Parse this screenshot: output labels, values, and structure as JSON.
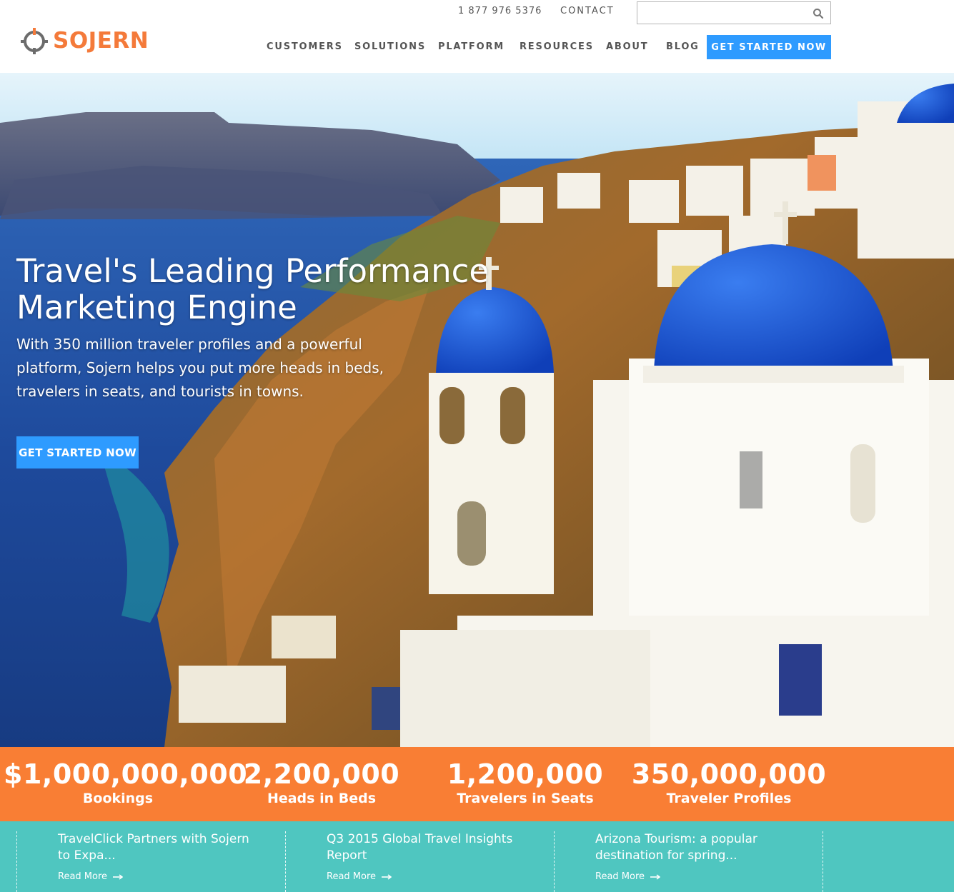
{
  "header": {
    "logo_text": "SOJERN",
    "phone": "1 877 976 5376",
    "contact": "CONTACT",
    "search_placeholder": "",
    "nav": [
      "CUSTOMERS",
      "SOLUTIONS",
      "PLATFORM",
      "RESOURCES",
      "ABOUT",
      "BLOG"
    ],
    "cta": "GET STARTED NOW"
  },
  "hero": {
    "title_line1": "Travel's Leading Performance",
    "title_line2": "Marketing Engine",
    "subtitle": "With 350 million traveler profiles and a powerful platform, Sojern helps you put more heads in beds, travelers in seats, and tourists in towns.",
    "cta": "GET STARTED NOW"
  },
  "stats": [
    {
      "value": "$1,000,000,000",
      "label": "Bookings"
    },
    {
      "value": "2,200,000",
      "label": "Heads in Beds"
    },
    {
      "value": "1,200,000",
      "label": "Travelers in Seats"
    },
    {
      "value": "350,000,000",
      "label": "Traveler Profiles"
    }
  ],
  "news": [
    {
      "title": "TravelClick Partners with Sojern to Expa...",
      "read_more": "Read More"
    },
    {
      "title": "Q3 2015 Global Travel Insights Report",
      "read_more": "Read More"
    },
    {
      "title": "Arizona Tourism: a popular destination for spring...",
      "read_more": "Read More"
    }
  ],
  "colors": {
    "brand_orange": "#f47a3a",
    "cta_blue": "#2e9bff",
    "stats_bar": "#f97e34",
    "news_bar": "#4fc6c0"
  }
}
